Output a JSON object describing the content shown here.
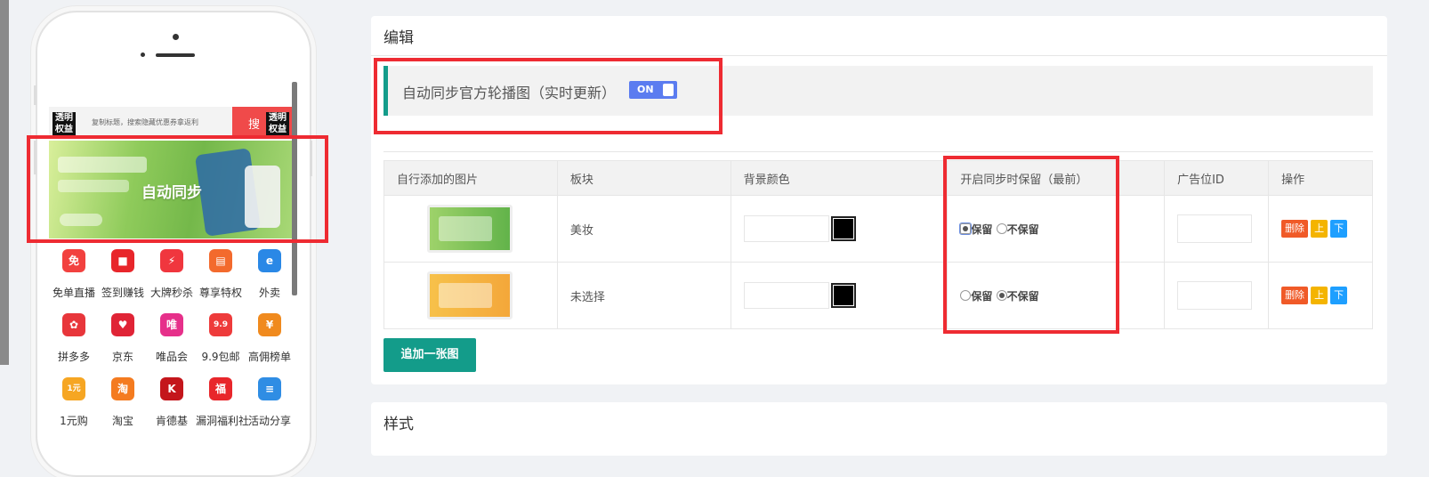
{
  "phone": {
    "brand_badge_left": "透明\n权益",
    "brand_badge_right": "透明\n权益",
    "search_hint": "复制标题，搜索隐藏优惠券拿返利",
    "search_button": "搜",
    "banner_text": "自动同步",
    "grid": [
      {
        "label": "免单直播",
        "icon": "gift-icon",
        "color": "#f2413f",
        "glyph": "免"
      },
      {
        "label": "签到赚钱",
        "icon": "red-envelope-icon",
        "color": "#e8262b",
        "glyph": "■"
      },
      {
        "label": "大牌秒杀",
        "icon": "alarm-clock-icon",
        "color": "#f0363e",
        "glyph": "⚡"
      },
      {
        "label": "尊享特权",
        "icon": "coupon-icon",
        "color": "#f36a2d",
        "glyph": "▤"
      },
      {
        "label": "外卖",
        "icon": "takeout-icon",
        "color": "#2a88e6",
        "glyph": "e"
      },
      {
        "label": "拼多多",
        "icon": "pinduoduo-icon",
        "color": "#e8363b",
        "glyph": "✿"
      },
      {
        "label": "京东",
        "icon": "jd-icon",
        "color": "#e02436",
        "glyph": "♥"
      },
      {
        "label": "唯品会",
        "icon": "vip-icon",
        "color": "#e6308a",
        "glyph": "唯"
      },
      {
        "label": "9.9包邮",
        "icon": "price-tag-icon",
        "color": "#ee3b3b",
        "glyph": "9.9"
      },
      {
        "label": "高佣榜单",
        "icon": "money-bag-icon",
        "color": "#f08a1e",
        "glyph": "¥"
      },
      {
        "label": "1元购",
        "icon": "one-yuan-icon",
        "color": "#f6a623",
        "glyph": "1元"
      },
      {
        "label": "淘宝",
        "icon": "taobao-icon",
        "color": "#f47b20",
        "glyph": "淘"
      },
      {
        "label": "肯德基",
        "icon": "kfc-icon",
        "color": "#c4161c",
        "glyph": "K"
      },
      {
        "label": "漏洞福利社",
        "icon": "welfare-icon",
        "color": "#e8262b",
        "glyph": "福"
      },
      {
        "label": "活动分享",
        "icon": "book-icon",
        "color": "#2f8de4",
        "glyph": "≡"
      }
    ]
  },
  "editor": {
    "title": "编辑",
    "sync_label": "自动同步官方轮播图（实时更新）",
    "sync_toggle": "ON",
    "table": {
      "headers": [
        "自行添加的图片",
        "板块",
        "背景颜色",
        "开启同步时保留（最前）",
        "广告位ID",
        "操作"
      ],
      "rows": [
        {
          "section": "美妆",
          "thumb": "green",
          "keep": true
        },
        {
          "section": "未选择",
          "thumb": "yellow",
          "keep": false
        }
      ],
      "keep_label": "保留",
      "no_keep_label": "不保留",
      "delete_label": "删除",
      "up_label": "上",
      "down_label": "下"
    },
    "add_button": "追加一张图"
  },
  "style_panel": {
    "title": "样式"
  },
  "colors": {
    "accent": "#139c8a",
    "toggle": "#5b7cf0",
    "highlight": "#ee2b32",
    "delete": "#f05a28",
    "up": "#f4b400",
    "down": "#1e9fff"
  }
}
